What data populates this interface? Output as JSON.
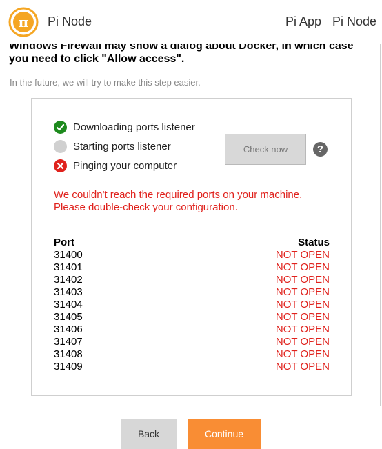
{
  "header": {
    "title": "Pi Node",
    "logo_symbol": "π",
    "nav": [
      {
        "label": "Pi App"
      },
      {
        "label": "Pi Node",
        "active": true
      }
    ]
  },
  "content": {
    "instruction_line1": "Windows Firewall may show a dialog about Docker, in which case",
    "instruction_line2": "you need to click \"Allow access\".",
    "future_note": "In the future, we will try to make this step easier."
  },
  "checks": {
    "steps": [
      {
        "label": "Downloading ports listener",
        "status": "success",
        "icon": "check-icon"
      },
      {
        "label": "Starting ports listener",
        "status": "pending",
        "icon": "pending-icon"
      },
      {
        "label": "Pinging your computer",
        "status": "error",
        "icon": "error-x-icon"
      }
    ],
    "check_now_label": "Check now",
    "help_symbol": "?",
    "error_line1": "We couldn't reach the required ports on your machine.",
    "error_line2": "Please double-check your configuration."
  },
  "ports": {
    "headers": {
      "port": "Port",
      "status": "Status"
    },
    "rows": [
      {
        "port": "31400",
        "status": "NOT OPEN"
      },
      {
        "port": "31401",
        "status": "NOT OPEN"
      },
      {
        "port": "31402",
        "status": "NOT OPEN"
      },
      {
        "port": "31403",
        "status": "NOT OPEN"
      },
      {
        "port": "31404",
        "status": "NOT OPEN"
      },
      {
        "port": "31405",
        "status": "NOT OPEN"
      },
      {
        "port": "31406",
        "status": "NOT OPEN"
      },
      {
        "port": "31407",
        "status": "NOT OPEN"
      },
      {
        "port": "31408",
        "status": "NOT OPEN"
      },
      {
        "port": "31409",
        "status": "NOT OPEN"
      }
    ]
  },
  "footer": {
    "back_label": "Back",
    "continue_label": "Continue"
  },
  "colors": {
    "accent": "#f98d34",
    "error": "#e0221d",
    "success": "#1d8a1d"
  }
}
